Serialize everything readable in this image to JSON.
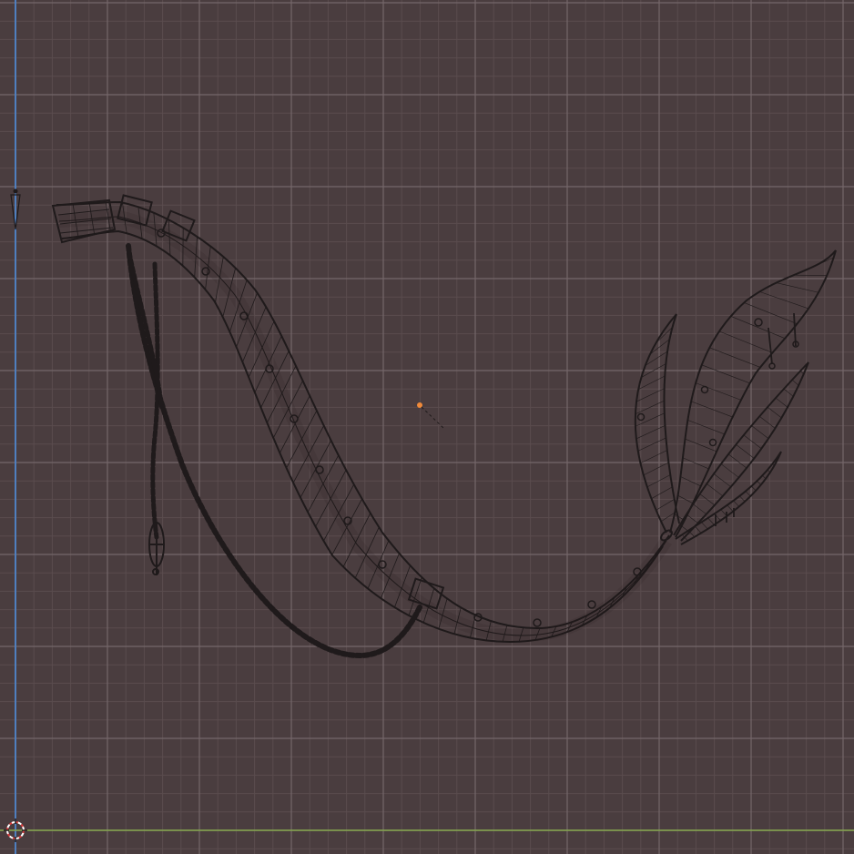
{
  "viewport": {
    "background_color": "#4a3d3f",
    "minor_grid_color": "#5a4c4e",
    "major_grid_color": "#74676a",
    "y_axis_color": "#4f7fbf",
    "x_axis_color": "#86a84f",
    "wire_color": "#1f1a1b",
    "origin_color": "#f08a3a",
    "cursor_color": "#d83c3c"
  },
  "icons": {
    "camera": "camera-icon",
    "object_origin": "object-origin-icon",
    "cursor": "3d-cursor-icon"
  }
}
